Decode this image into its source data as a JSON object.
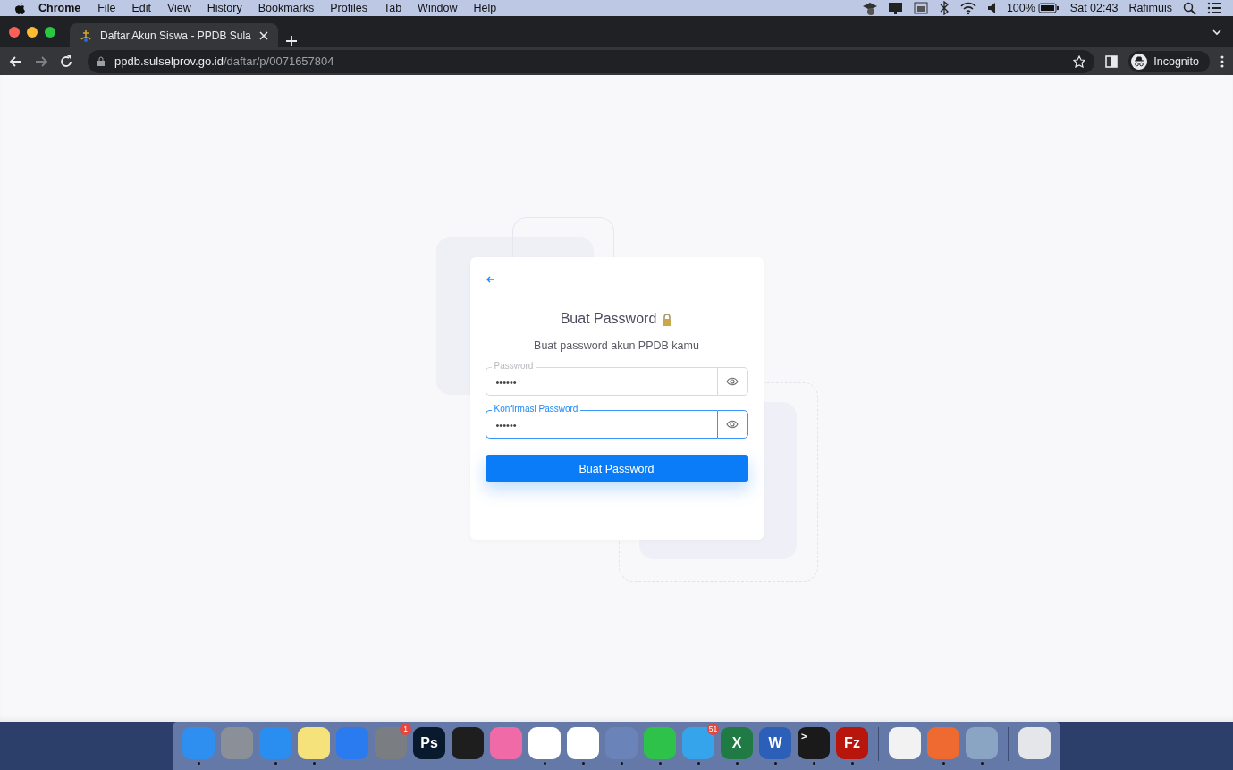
{
  "menu_bar": {
    "app": "Chrome",
    "items": [
      "File",
      "Edit",
      "View",
      "History",
      "Bookmarks",
      "Profiles",
      "Tab",
      "Window",
      "Help"
    ],
    "battery": "100%",
    "clock": "Sat 02:43",
    "user": "Rafimuis"
  },
  "browser": {
    "tabs": [
      {
        "title": "Daftar Akun Siswa - PPDB Sula",
        "selected": true
      }
    ],
    "url_host": "ppdb.sulselprov.go.id",
    "url_path": "/daftar/p/0071657804",
    "profile": "Incognito"
  },
  "card": {
    "title": "Buat Password",
    "subtitle": "Buat password akun PPDB kamu",
    "fields": [
      {
        "label": "Password",
        "value": "••••••",
        "focused": false
      },
      {
        "label": "Konfirmasi Password",
        "value": "••••••",
        "focused": true
      }
    ],
    "submit": "Buat Password"
  },
  "dock": {
    "apps": [
      {
        "color": "#2f8ff0",
        "running": true
      },
      {
        "color": "#8a8f98",
        "running": false
      },
      {
        "color": "#2a8df0",
        "running": true
      },
      {
        "color": "#f6e27a",
        "running": true
      },
      {
        "color": "#2a7af0",
        "running": false
      },
      {
        "color": "#7a7d82",
        "running": false,
        "badge": "1"
      },
      {
        "color": "#0a1a2e",
        "running": false,
        "glyph": "Ps"
      },
      {
        "color": "#1e1e1e",
        "running": false
      },
      {
        "color": "#f06aa8",
        "running": false
      },
      {
        "color": "#ffffff",
        "running": true
      },
      {
        "color": "#ffffff",
        "running": true
      },
      {
        "color": "#6a83b8",
        "running": true
      },
      {
        "color": "#2fc24a",
        "running": true
      },
      {
        "color": "#36a4ea",
        "running": true,
        "badge": "51"
      },
      {
        "color": "#1f7a44",
        "running": true,
        "glyph": "X"
      },
      {
        "color": "#2b5fb8",
        "running": true,
        "glyph": "W"
      },
      {
        "color": "#1a1a1a",
        "running": true,
        "glyph": ">_"
      },
      {
        "color": "#b8150c",
        "running": true,
        "glyph": "Fz"
      },
      {
        "color": "#f2f2f2",
        "running": false,
        "separator_before": true
      },
      {
        "color": "#ef6a30",
        "running": true
      },
      {
        "color": "#8aa4c4",
        "running": true
      },
      {
        "color": "#e4e6ea",
        "running": false,
        "separator_before": true
      }
    ]
  }
}
